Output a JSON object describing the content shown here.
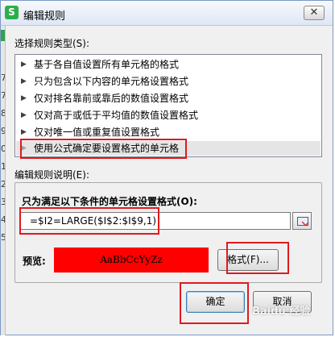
{
  "window": {
    "title": "编辑规则",
    "app_icon_letter": "S",
    "close_label": "✕"
  },
  "sheet_row_numbers": [
    "7",
    "7",
    "8",
    "9",
    "0",
    "1",
    "2",
    "3",
    "4",
    "5"
  ],
  "rule_type": {
    "label": "选择规则类型(S):",
    "items": [
      "基于各自值设置所有单元格的格式",
      "只为包含以下内容的单元格设置格式",
      "仅对排名靠前或靠后的数值设置格式",
      "仅对高于或低于平均值的数值设置格式",
      "仅对唯一值或重复值设置格式",
      "使用公式确定要设置格式的单元格"
    ],
    "selected_index": 5
  },
  "rule_description": {
    "label": "编辑规则说明(E):",
    "formula_label": "只为满足以下条件的单元格设置格式(O):",
    "formula_value": "=$I2=LARGE($I$2:$I$9,1)",
    "preview_label": "预览:",
    "preview_text": "AaBbCcYyZz",
    "preview_fill": "#ff0000",
    "format_button": "格式(F)..."
  },
  "buttons": {
    "ok": "确定",
    "cancel": "取消"
  },
  "watermark": "Baidu 经验",
  "colors": {
    "highlight": "#e0191e",
    "titlebar": "#dde7f4",
    "app_icon": "#2eae4b"
  }
}
